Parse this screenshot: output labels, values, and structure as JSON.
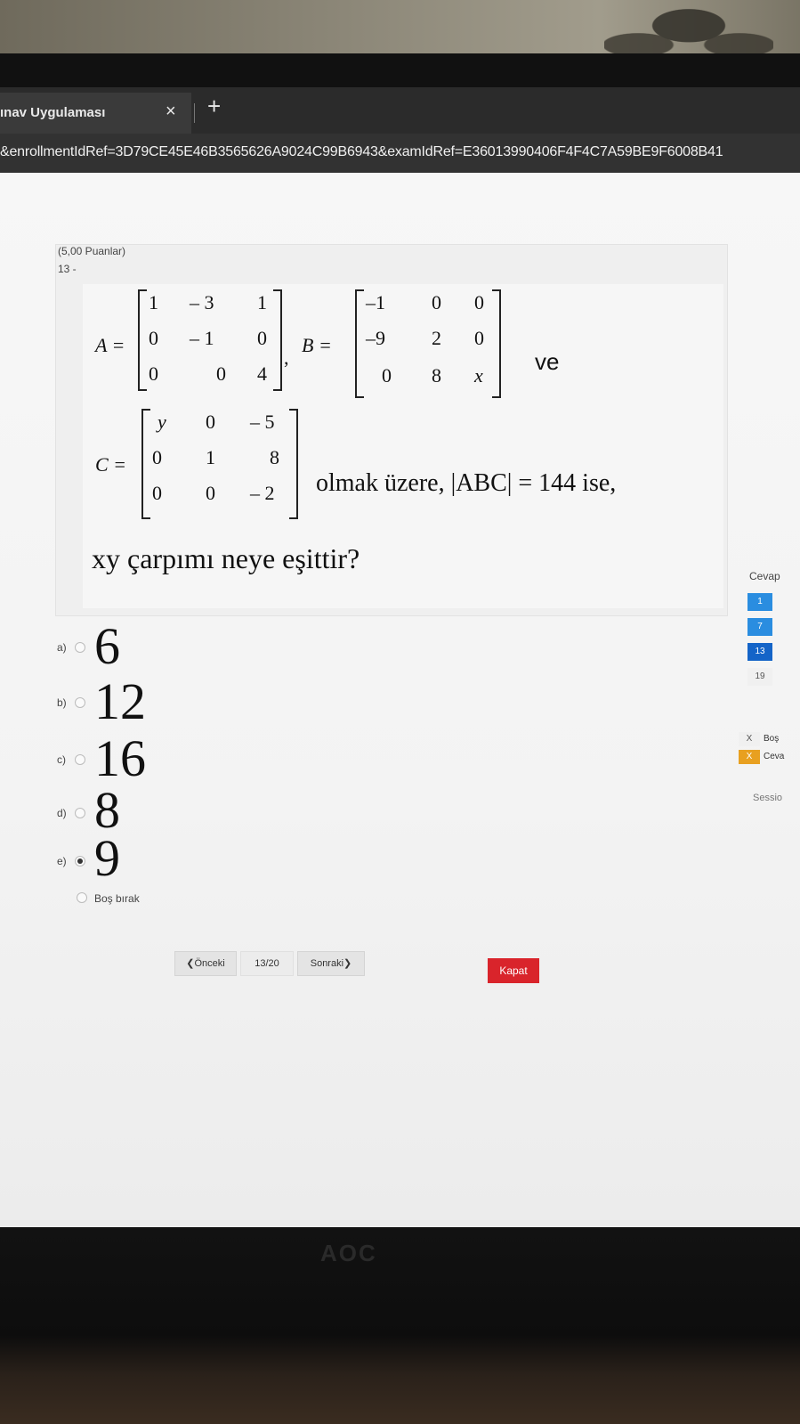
{
  "browser": {
    "tab_title": "ınav Uygulaması",
    "tab_close": "×",
    "new_tab": "+",
    "url": "&enrollmentIdRef=3D79CE45E46B3565626A9024C99B6943&examIdRef=E36013990406F4F4C7A59BE9F6008B41"
  },
  "monitor": {
    "brand": "AOC"
  },
  "question": {
    "points": "(5,00 Puanlar)",
    "number": "13 -",
    "matrices": {
      "A": {
        "label": "A =",
        "rows": [
          [
            "1",
            "– 3",
            "1"
          ],
          [
            "0",
            "– 1",
            "0"
          ],
          [
            "0",
            "0",
            "4"
          ]
        ]
      },
      "B": {
        "label": "B =",
        "rows": [
          [
            "–1",
            "0",
            "0"
          ],
          [
            "–9",
            "2",
            "0"
          ],
          [
            "0",
            "8",
            "x"
          ]
        ]
      },
      "C": {
        "label": "C =",
        "rows": [
          [
            "y",
            "0",
            "– 5"
          ],
          [
            "0",
            "1",
            "8"
          ],
          [
            "0",
            "0",
            "– 2"
          ]
        ]
      }
    },
    "comma": ",",
    "connector": "ve",
    "condition": "olmak üzere, |ABC| = 144 ise,",
    "prompt": "xy çarpımı neye eşittir?"
  },
  "options": [
    {
      "letter": "a)",
      "value": "6",
      "selected": false
    },
    {
      "letter": "b)",
      "value": "12",
      "selected": false
    },
    {
      "letter": "c)",
      "value": "16",
      "selected": false
    },
    {
      "letter": "d)",
      "value": "8",
      "selected": false
    },
    {
      "letter": "e)",
      "value": "9",
      "selected": true
    }
  ],
  "leave_blank": "Boş bırak",
  "navigation": {
    "prev": "❮Önceki",
    "counter": "13/20",
    "next": "Sonraki❯",
    "close": "Kapat"
  },
  "sidebar": {
    "title": "Cevap",
    "questions": [
      {
        "label": "1",
        "state": "answered"
      },
      {
        "label": "7",
        "state": "answered"
      },
      {
        "label": "13",
        "state": "current"
      },
      {
        "label": "19",
        "state": "unanswered"
      }
    ],
    "legend": [
      {
        "mark": "X",
        "label": "Boş",
        "color": "#f0f0f0"
      },
      {
        "mark": "X",
        "label": "Ceva",
        "color": "#e8a020"
      }
    ],
    "session": "Sessio"
  }
}
